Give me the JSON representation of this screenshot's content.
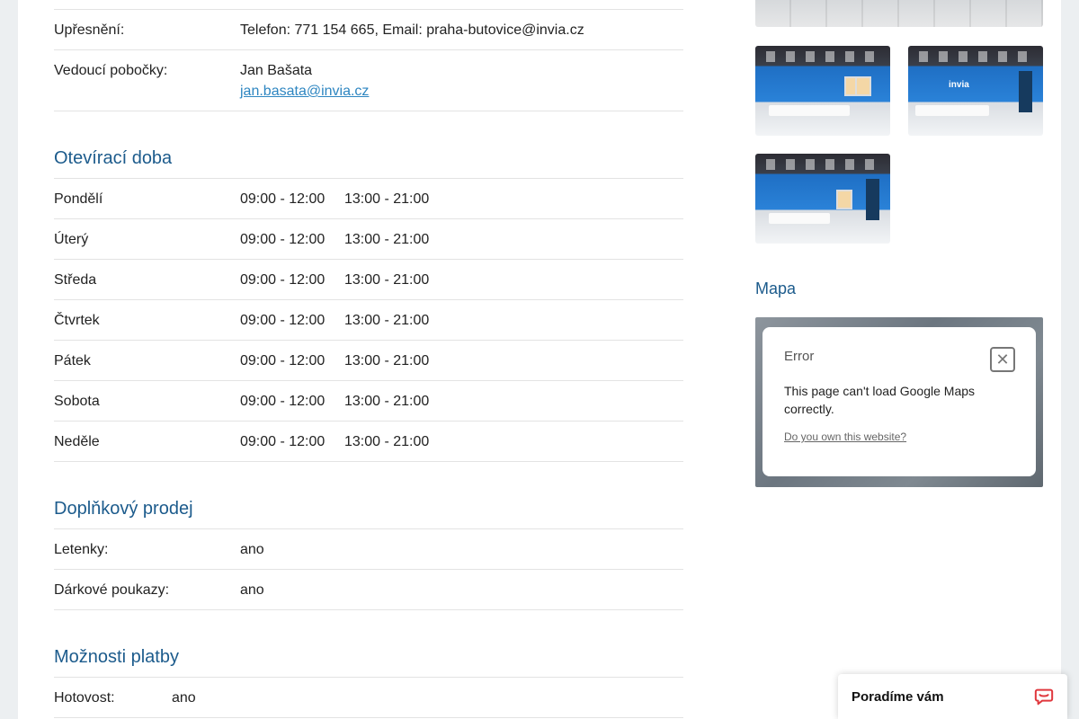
{
  "details": {
    "rows": [
      {
        "label": "Upřesnění:",
        "value": "Telefon: 771 154 665, Email: praha-butovice@invia.cz"
      },
      {
        "label": "Vedoucí pobočky:",
        "name": "Jan Bašata",
        "email": "jan.basata@invia.cz"
      }
    ]
  },
  "hours": {
    "title": "Otevírací doba",
    "days": [
      {
        "day": "Pondělí",
        "am": "09:00 - 12:00",
        "pm": "13:00 - 21:00"
      },
      {
        "day": "Úterý",
        "am": "09:00 - 12:00",
        "pm": "13:00 - 21:00"
      },
      {
        "day": "Středa",
        "am": "09:00 - 12:00",
        "pm": "13:00 - 21:00"
      },
      {
        "day": "Čtvrtek",
        "am": "09:00 - 12:00",
        "pm": "13:00 - 21:00"
      },
      {
        "day": "Pátek",
        "am": "09:00 - 12:00",
        "pm": "13:00 - 21:00"
      },
      {
        "day": "Sobota",
        "am": "09:00 - 12:00",
        "pm": "13:00 - 21:00"
      },
      {
        "day": "Neděle",
        "am": "09:00 - 12:00",
        "pm": "13:00 - 21:00"
      }
    ]
  },
  "extra_sales": {
    "title": "Doplňkový prodej",
    "rows": [
      {
        "label": "Letenky:",
        "value": "ano"
      },
      {
        "label": "Dárkové poukazy:",
        "value": "ano"
      }
    ]
  },
  "payment": {
    "title": "Možnosti platby",
    "rows": [
      {
        "label": "Hotovost:",
        "value": "ano"
      }
    ]
  },
  "gallery": {
    "logo_text": "invia"
  },
  "map": {
    "title": "Mapa",
    "error_title": "Error",
    "error_message": "This page can't load Google Maps correctly.",
    "own_link": "Do you own this website?"
  },
  "chat": {
    "label": "Poradíme vám",
    "accent": "#e0383e"
  },
  "colors": {
    "heading": "#1c5b8c",
    "link": "#2e86c1"
  }
}
